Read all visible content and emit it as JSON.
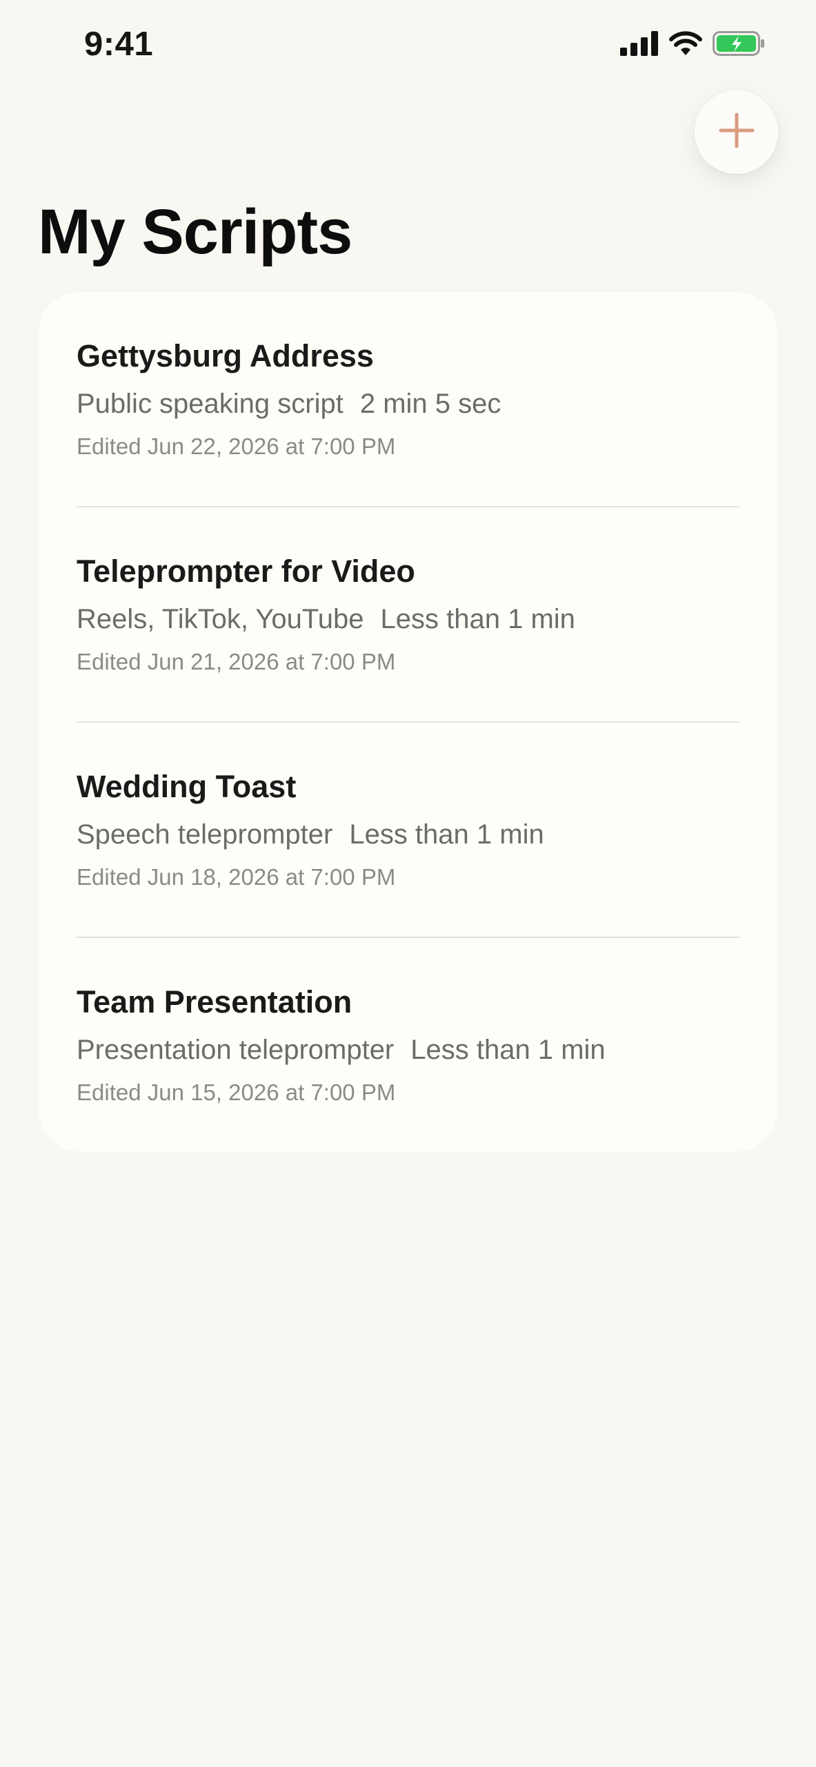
{
  "status_bar": {
    "time": "9:41",
    "icons": [
      "cellular-signal-icon",
      "wifi-icon",
      "battery-charging-icon"
    ]
  },
  "header": {
    "add_button_icon": "plus-icon",
    "title": "My Scripts"
  },
  "colors": {
    "background": "#f9f7f2",
    "card": "#fefdf7",
    "accent": "#d99a80",
    "battery": "#34c759"
  },
  "scripts": [
    {
      "title": "Gettysburg Address",
      "category": "Public speaking script",
      "duration": "2 min 5 sec",
      "edited": "Edited Jun 22, 2026 at 7:00 PM"
    },
    {
      "title": "Teleprompter for Video",
      "category": "Reels, TikTok, YouTube",
      "duration": "Less than 1 min",
      "edited": "Edited Jun 21, 2026 at 7:00 PM"
    },
    {
      "title": "Wedding Toast",
      "category": "Speech teleprompter",
      "duration": "Less than 1 min",
      "edited": "Edited Jun 18, 2026 at 7:00 PM"
    },
    {
      "title": "Team Presentation",
      "category": "Presentation teleprompter",
      "duration": "Less than 1 min",
      "edited": "Edited Jun 15, 2026 at 7:00 PM"
    }
  ]
}
